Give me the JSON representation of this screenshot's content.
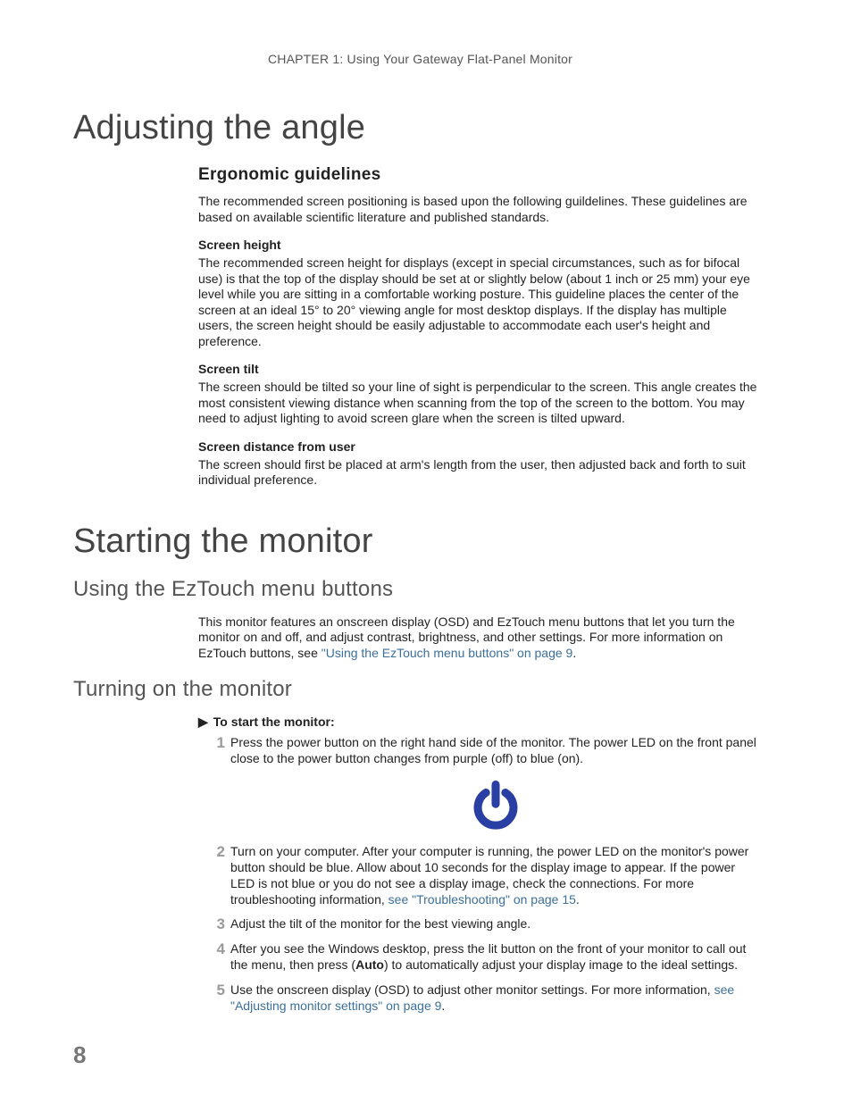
{
  "chapter_header": "CHAPTER 1: Using Your Gateway Flat-Panel Monitor",
  "h1_a": "Adjusting the angle",
  "ergo": {
    "title": "Ergonomic guidelines",
    "intro": "The recommended screen positioning is based upon the following guildelines. These guidelines are based on available scientific literature and published standards.",
    "sh_head": "Screen height",
    "sh_body": "The recommended screen height for displays (except in special circumstances, such as for bifocal use) is that the top of the display should be set at or slightly below (about 1 inch or 25 mm) your eye level while you are sitting in a comfortable working posture. This guideline places the center of the screen at an ideal 15° to 20° viewing angle for most desktop displays. If the display has multiple users, the screen height should be easily adjustable to accommodate each user's height and preference.",
    "st_head": "Screen tilt",
    "st_body": "The screen should be tilted so your line of sight is perpendicular to the screen. This angle creates the most consistent viewing distance when scanning from the top of the screen to the bottom. You may need to adjust lighting to avoid screen glare when the screen is tilted upward.",
    "sd_head": "Screen distance from user",
    "sd_body": "The screen should first be placed at arm's length from the user, then adjusted back and forth to suit individual preference."
  },
  "h1_b": "Starting the monitor",
  "eztouch": {
    "title": "Using the EzTouch menu buttons",
    "body_pre": "This monitor features an onscreen display (OSD) and EzTouch menu buttons that let you turn the monitor on and off, and adjust contrast, brightness, and other settings. For more information on EzTouch buttons, see ",
    "xref": "\"Using the EzTouch menu buttons\" on page 9",
    "body_post": "."
  },
  "turnon": {
    "title": "Turning on the monitor",
    "lead": "To start the monitor:",
    "step1": "Press the power button on the right hand side of the monitor. The power LED on the front panel close to the power button changes from purple (off) to blue (on).",
    "step2_pre": "Turn on your computer. After your computer is running, the power LED on the monitor's power button should be blue. Allow about 10 seconds for the display image to appear. If the power LED is not blue or you do not see a display image, check the connections. For more troubleshooting information, ",
    "step2_xref": "see \"Troubleshooting\" on page 15",
    "step2_post": ".",
    "step3": "Adjust the tilt of the monitor for the best viewing angle.",
    "step4_a": "After you see the Windows desktop, press the lit button on the front of your monitor to call out the menu, then press (",
    "step4_bold": "Auto",
    "step4_b": ") to automatically adjust your display image to the ideal settings.",
    "step5_pre": "Use the onscreen display (OSD) to adjust other monitor settings. For more information, ",
    "step5_xref": "see \"Adjusting monitor settings\" on page 9",
    "step5_post": "."
  },
  "page_number": "8",
  "power_icon_color": "#2a3fa3"
}
